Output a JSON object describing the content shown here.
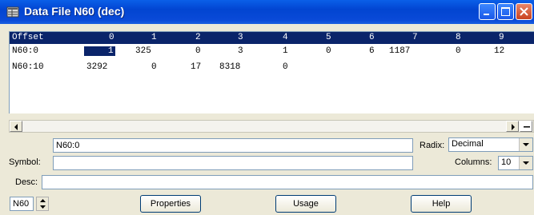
{
  "window": {
    "title": "Data File N60 (dec)"
  },
  "grid": {
    "headers": [
      "Offset",
      "0",
      "1",
      "2",
      "3",
      "4",
      "5",
      "6",
      "7",
      "8",
      "9"
    ],
    "rows": [
      {
        "offset": "N60:0",
        "cells": [
          "1",
          "325",
          "0",
          "3",
          "1",
          "0",
          "6",
          "1187",
          "0",
          "12"
        ]
      },
      {
        "offset": "N60:10",
        "cells": [
          "3292",
          "0",
          "17",
          "8318",
          "0",
          "",
          "",
          "",
          "",
          ""
        ]
      }
    ],
    "selected_cell": "1"
  },
  "address_field": "N60:0",
  "labels": {
    "radix": "Radix:",
    "symbol": "Symbol:",
    "columns": "Columns:",
    "desc": "Desc:"
  },
  "radix_value": "Decimal",
  "columns_value": "10",
  "symbol_value": "",
  "desc_value": "",
  "file_spinner_value": "N60",
  "buttons": {
    "properties": "Properties",
    "usage": "Usage",
    "help": "Help"
  },
  "icons": [
    "data-file-icon",
    "minimize-icon",
    "maximize-icon",
    "close-icon",
    "scroll-left-icon",
    "scroll-right-icon",
    "dropdown-arrow-icon",
    "spin-up-icon",
    "spin-down-icon"
  ]
}
